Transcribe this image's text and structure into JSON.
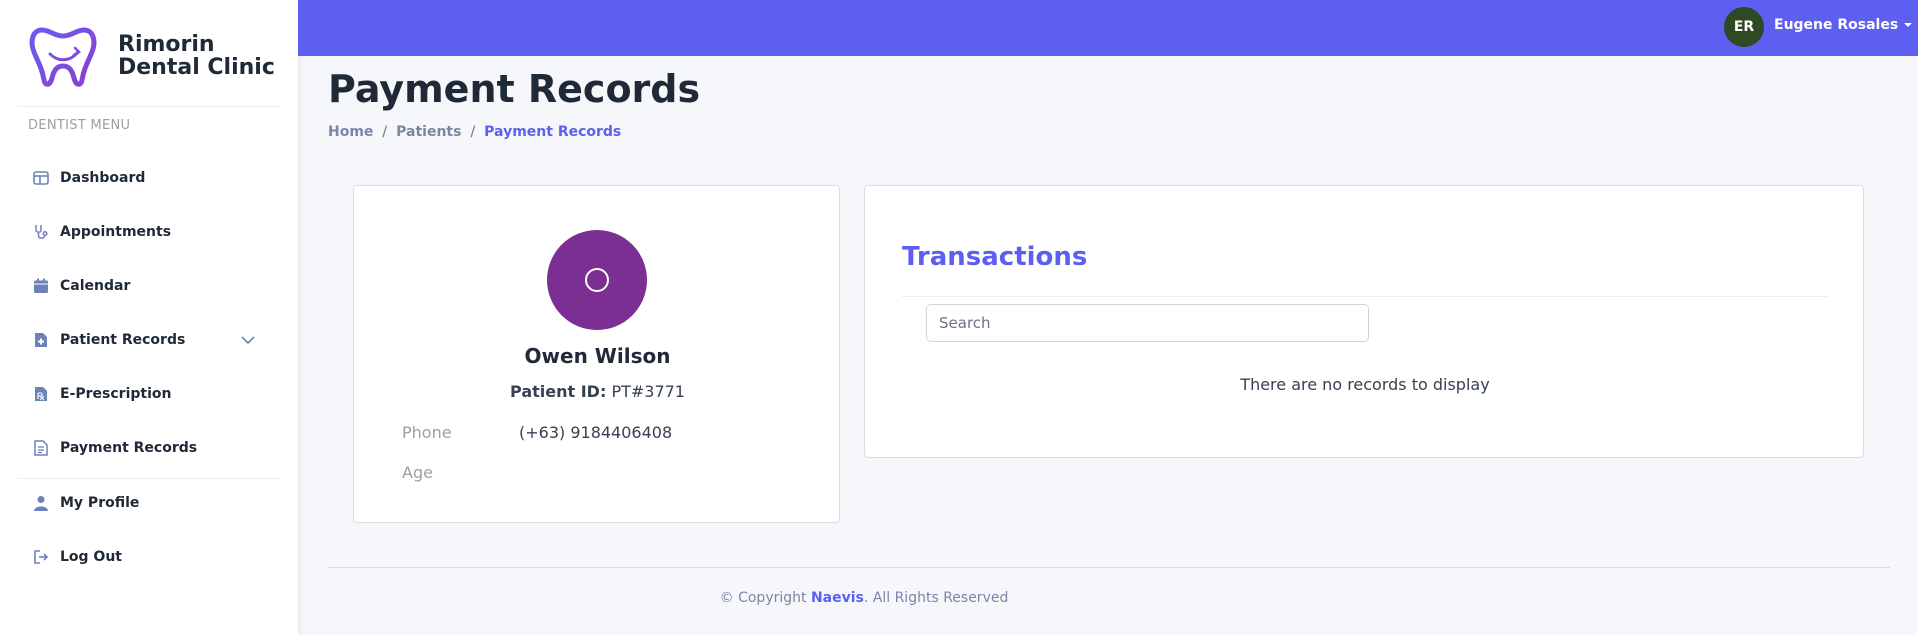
{
  "sidebar": {
    "brand": {
      "line1": "Rimorin",
      "line2": "Dental Clinic"
    },
    "heading": "DENTIST MENU",
    "items": [
      {
        "label": "Dashboard",
        "icon": "dashboard-icon"
      },
      {
        "label": "Appointments",
        "icon": "stethoscope-icon"
      },
      {
        "label": "Calendar",
        "icon": "calendar-icon"
      },
      {
        "label": "Patient Records",
        "icon": "file-medical-icon"
      },
      {
        "label": "E-Prescription",
        "icon": "prescription-icon"
      },
      {
        "label": "Payment Records",
        "icon": "receipt-icon"
      }
    ],
    "account_items": [
      {
        "label": "My Profile",
        "icon": "user-icon"
      },
      {
        "label": "Log Out",
        "icon": "logout-icon"
      }
    ]
  },
  "topbar": {
    "avatar_initials": "ER",
    "user_name": "Eugene Rosales"
  },
  "page": {
    "title": "Payment Records",
    "breadcrumb": [
      "Home",
      "Patients",
      "Payment Records"
    ]
  },
  "profile": {
    "name": "Owen Wilson",
    "id_label": "Patient ID:",
    "id_value": "PT#3771",
    "phone_label": "Phone",
    "phone_value": "(+63) 9184406408",
    "age_label": "Age",
    "age_value": ""
  },
  "transactions": {
    "title": "Transactions",
    "search_placeholder": "Search",
    "empty_message": "There are no records to display"
  },
  "footer": {
    "prefix": "© Copyright",
    "brand": "Naevis",
    "suffix": ". All Rights Reserved"
  },
  "colors": {
    "accent": "#5c5fef",
    "avatar_user": "#2f4a22",
    "avatar_patient": "#7b2f93"
  }
}
